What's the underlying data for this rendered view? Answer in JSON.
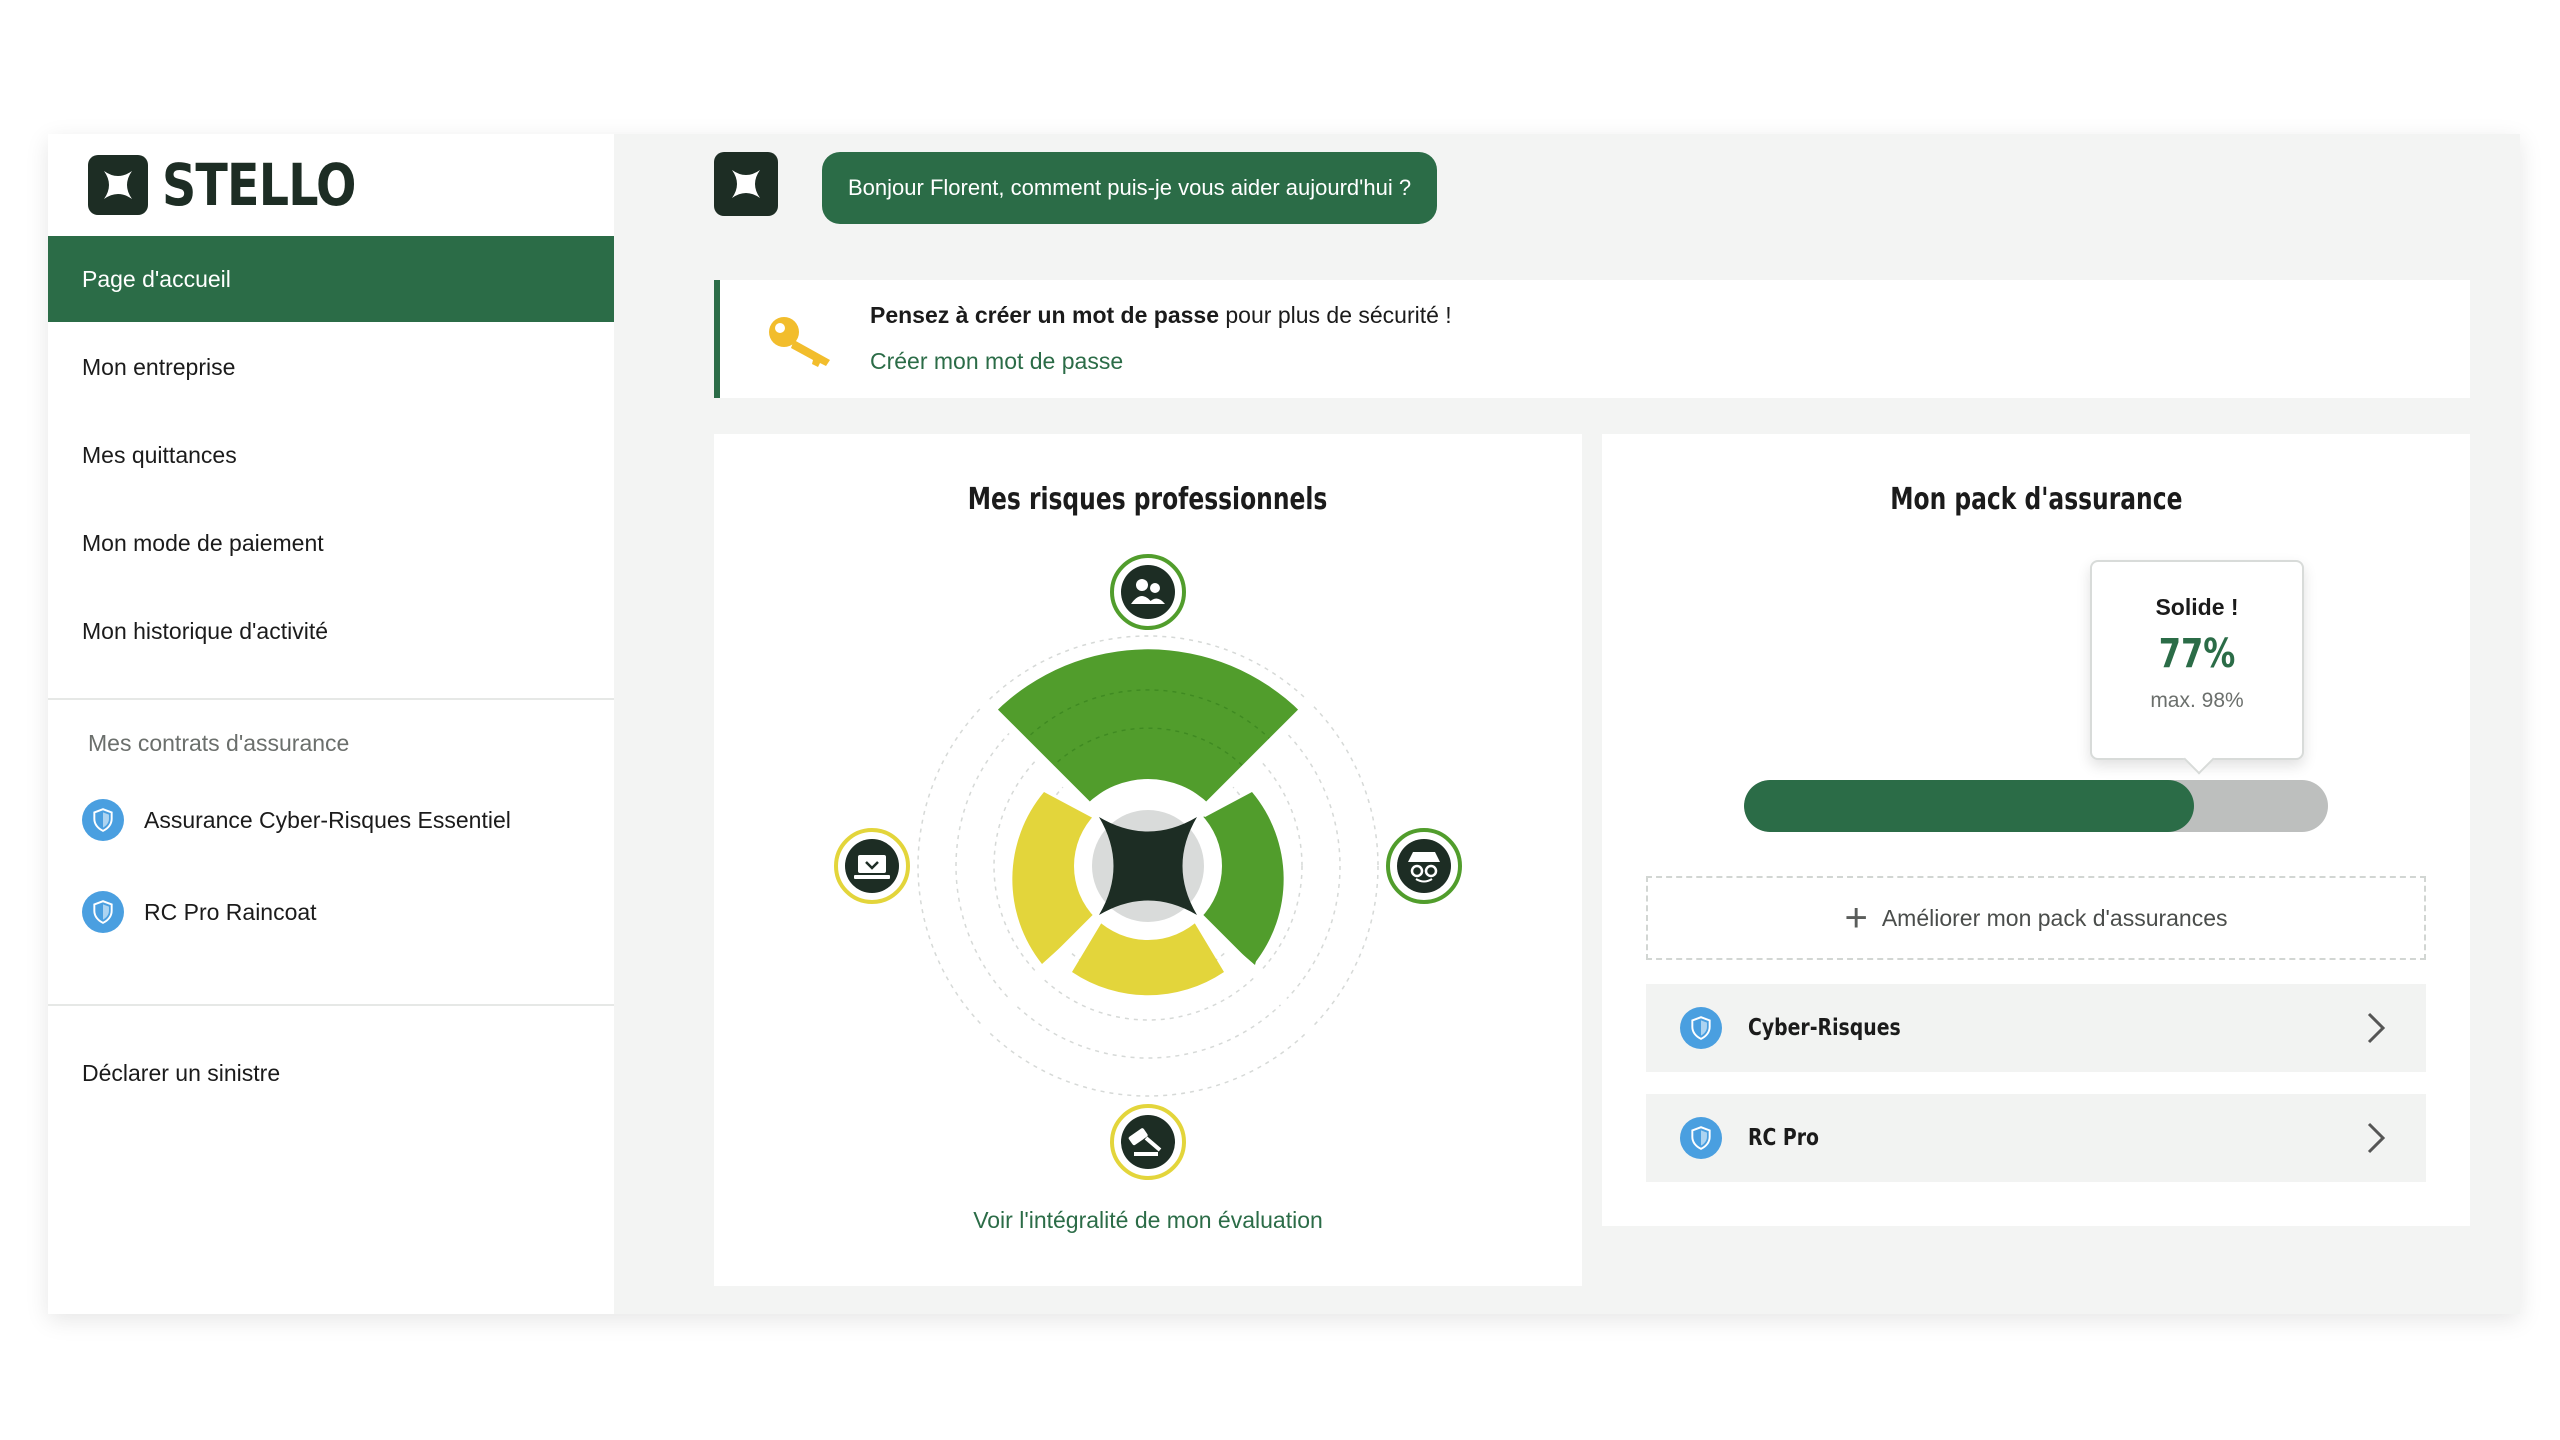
{
  "brand": {
    "name": "STELLO",
    "color": "#2b6c47",
    "dark": "#1d2d24"
  },
  "sidebar": {
    "items": [
      {
        "label": "Page d'accueil",
        "active": true
      },
      {
        "label": "Mon entreprise"
      },
      {
        "label": "Mes quittances"
      },
      {
        "label": "Mon mode de paiement"
      },
      {
        "label": "Mon historique d'activité"
      }
    ],
    "contracts_title": "Mes contrats d'assurance",
    "contracts": [
      {
        "label": "Assurance Cyber-Risques Essentiel",
        "icon": "shield-icon"
      },
      {
        "label": "RC Pro Raincoat",
        "icon": "shield-icon"
      }
    ],
    "declare_label": "Déclarer un sinistre"
  },
  "assistant": {
    "greeting": "Bonjour Florent, comment puis-je vous aider aujourd'hui ?"
  },
  "banner": {
    "bold": "Pensez à créer un mot de passe",
    "rest": " pour plus de sécurité !",
    "link": "Créer mon mot de passe",
    "icon": "key-icon"
  },
  "risks": {
    "title": "Mes risques professionnels",
    "link": "Voir l'intégralité de mon évaluation",
    "icons": [
      "team-icon",
      "hacker-icon",
      "gavel-icon",
      "laptop-icon"
    ]
  },
  "pack": {
    "title": "Mon pack d'assurance",
    "rating_label": "Solide !",
    "score_text": "77%",
    "max_text": "max. 98%",
    "score": 77,
    "max": 98,
    "upgrade_label": "Améliorer mon pack d'assurances",
    "products": [
      {
        "name": "Cyber-Risques"
      },
      {
        "name": "RC Pro"
      }
    ]
  }
}
